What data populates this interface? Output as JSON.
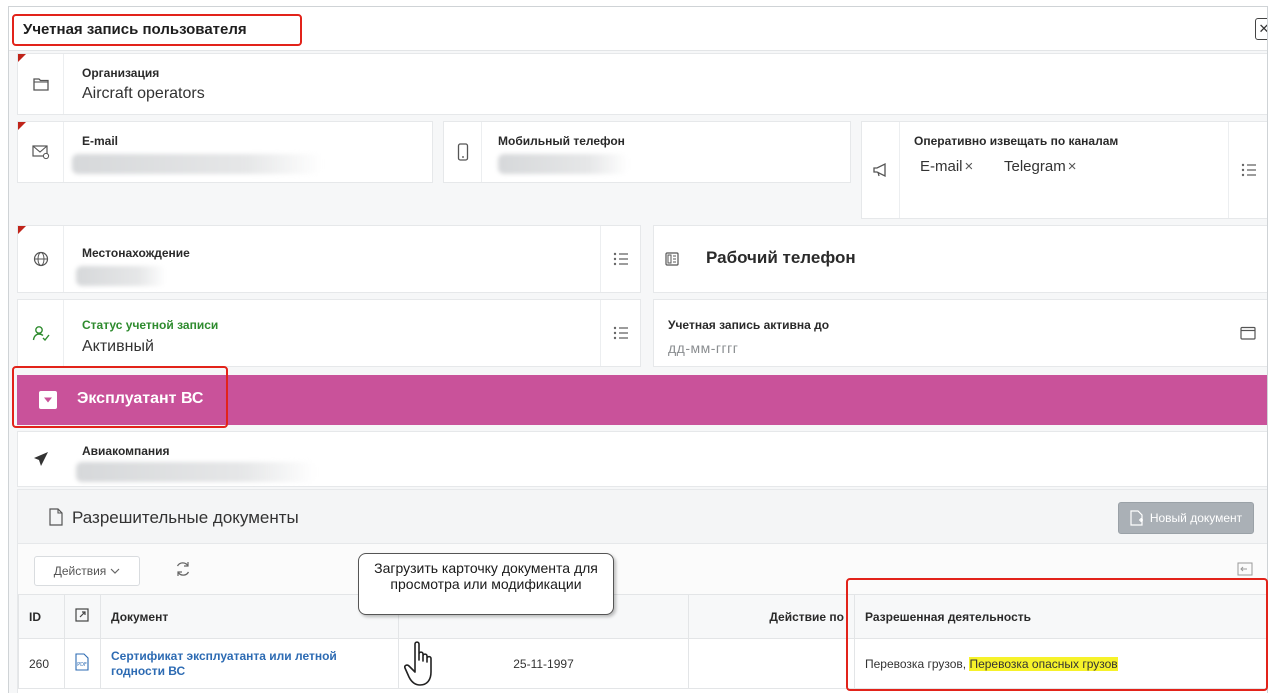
{
  "window": {
    "title": "Учетная запись пользователя",
    "close_glyph": "✕"
  },
  "fields": {
    "organization": {
      "label": "Организация",
      "value": "Aircraft operators",
      "icon": "folder-icon"
    },
    "email": {
      "label": "E-mail",
      "icon": "email-icon"
    },
    "mobile_phone": {
      "label": "Мобильный телефон",
      "icon": "mobile-phone-icon"
    },
    "notify_channels": {
      "label": "Оперативно извещать по каналам",
      "icon": "megaphone-icon",
      "chips": [
        "E-mail",
        "Telegram"
      ],
      "remove_glyph": "×"
    },
    "location": {
      "label": "Местонахождение",
      "icon": "globe-icon"
    },
    "work_phone": {
      "label": "Рабочий телефон",
      "icon": "desk-phone-icon"
    },
    "account_status": {
      "label": "Статус учетной записи",
      "value": "Активный",
      "icon": "user-status-icon",
      "label_color": "#2e8b2e"
    },
    "active_until": {
      "label": "Учетная запись активна до",
      "placeholder": "дд-мм-гггг",
      "icon": "calendar-icon"
    }
  },
  "section": {
    "title": "Эксплуатант ВС",
    "color": "#c9529a",
    "airline": {
      "label": "Авиакомпания",
      "icon": "paper-plane-icon"
    }
  },
  "documents": {
    "title": "Разрешительные документы",
    "new_button": "Новый документ",
    "actions_button": "Действия",
    "columns": {
      "id": "ID",
      "document": "Документ",
      "date": "",
      "action_by": "Действие по",
      "activity": "Разрешенная деятельность"
    },
    "rows": [
      {
        "id": "260",
        "document": "Сертификат эксплуатанта или летной годности ВС",
        "date": "25-11-1997",
        "action_by": "",
        "activity_plain": "Перевозка грузов, ",
        "activity_highlight": "Перевозка опасных грузов"
      }
    ]
  },
  "tooltip": {
    "text": "Загрузить карточку документа для просмотра или модификации"
  },
  "colors": {
    "annotation_red": "#e2231a",
    "link_blue": "#2d6bb3",
    "highlight_yellow": "#f6f22a"
  }
}
